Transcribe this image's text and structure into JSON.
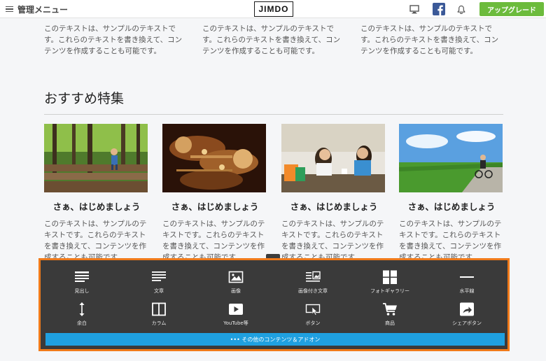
{
  "topbar": {
    "menu_label": "管理メニュー",
    "logo_text": "JIMDO",
    "icons": [
      "desktop-preview-icon",
      "facebook-icon",
      "bell-icon"
    ],
    "upgrade_label": "アップグレード",
    "upgrade_color": "#6cbb3c"
  },
  "top_texts": [
    "このテキストは、サンプルのテキストです。これらのテキストを書き換えて、コンテンツを作成することも可能です。",
    "このテキストは、サンプルのテキストです。これらのテキストを書き換えて、コンテンツを作成することも可能です。",
    "このテキストは、サンプルのテキストです。これらのテキストを書き換えて、コンテンツを作成することも可能です。"
  ],
  "section": {
    "title": "おすすめ特集"
  },
  "cards": [
    {
      "title": "さぁ、はじめましょう",
      "text": "このテキストは、サンプルのテキストです。これらのテキストを書き換えて、コンテンツを作成することも可能です。",
      "image": "forest-child-photo"
    },
    {
      "title": "さぁ、はじめましょう",
      "text": "このテキストは、サンプルのテキストです。これらのテキストを書き換えて、コンテンツを作成することも可能です。",
      "image": "trumpets-photo"
    },
    {
      "title": "さぁ、はじめましょう",
      "text": "このテキストは、サンプルのテキストです。これらのテキストを書き換えて、コンテンツを作成することも可能です。",
      "image": "cafe-women-photo"
    },
    {
      "title": "さぁ、はじめましょう",
      "text": "このテキストは、サンプルのテキストです。これらのテキストを書き換えて、コンテンツを作成することも可能です。",
      "image": "cycling-road-photo"
    }
  ],
  "panel": {
    "border_color": "#f07a1a",
    "widgets_row1": [
      {
        "label": "見出し",
        "icon": "heading-icon"
      },
      {
        "label": "文章",
        "icon": "text-icon"
      },
      {
        "label": "画像",
        "icon": "image-icon"
      },
      {
        "label": "画像付き文章",
        "icon": "text-with-image-icon"
      },
      {
        "label": "フォトギャラリー",
        "icon": "photo-gallery-icon"
      },
      {
        "label": "水平線",
        "icon": "horizontal-line-icon"
      }
    ],
    "widgets_row2": [
      {
        "label": "余白",
        "icon": "spacing-icon"
      },
      {
        "label": "カラム",
        "icon": "columns-icon"
      },
      {
        "label": "YouTube等",
        "icon": "video-icon"
      },
      {
        "label": "ボタン",
        "icon": "button-icon"
      },
      {
        "label": "商品",
        "icon": "cart-icon"
      },
      {
        "label": "シェアボタン",
        "icon": "share-icon"
      }
    ],
    "more_label": "••• その他のコンテンツ＆アドオン",
    "more_color": "#1fa0e0"
  }
}
